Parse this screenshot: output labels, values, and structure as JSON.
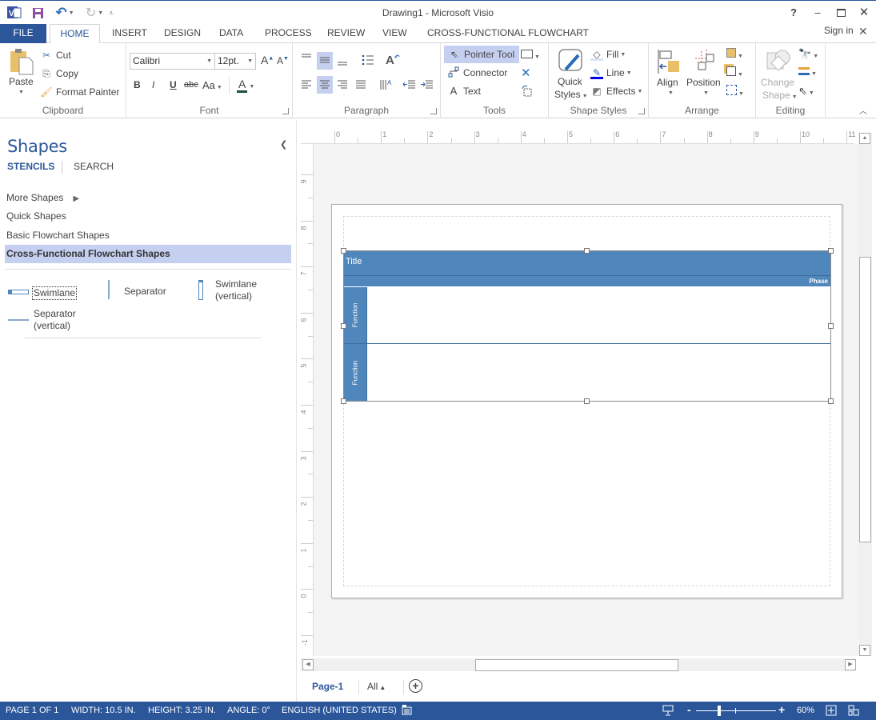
{
  "window": {
    "title": "Drawing1 - Microsoft Visio",
    "help": "?",
    "sign_in": "Sign in"
  },
  "tabs": [
    {
      "label": "FILE"
    },
    {
      "label": "HOME"
    },
    {
      "label": "INSERT"
    },
    {
      "label": "DESIGN"
    },
    {
      "label": "DATA"
    },
    {
      "label": "PROCESS"
    },
    {
      "label": "REVIEW"
    },
    {
      "label": "VIEW"
    },
    {
      "label": "CROSS-FUNCTIONAL FLOWCHART"
    }
  ],
  "ribbon": {
    "clipboard": {
      "label": "Clipboard",
      "paste": "Paste",
      "cut": "Cut",
      "copy": "Copy",
      "format_painter": "Format Painter"
    },
    "font": {
      "label": "Font",
      "font_name": "Calibri",
      "font_size": "12pt.",
      "bold": "B",
      "italic": "I",
      "underline": "U",
      "strike": "abc",
      "case": "Aa",
      "color_glyph": "A",
      "font_color": "#1f4e45"
    },
    "paragraph": {
      "label": "Paragraph"
    },
    "tools": {
      "label": "Tools",
      "pointer": "Pointer Tool",
      "connector": "Connector",
      "text": "Text"
    },
    "shape_styles": {
      "label": "Shape Styles",
      "quick_styles_1": "Quick",
      "quick_styles_2": "Styles",
      "fill": "Fill",
      "line": "Line",
      "effects": "Effects"
    },
    "arrange": {
      "label": "Arrange",
      "align": "Align",
      "position": "Position"
    },
    "editing": {
      "label": "Editing",
      "change_shape_1": "Change",
      "change_shape_2": "Shape"
    }
  },
  "shapes_panel": {
    "title": "Shapes",
    "tabs": [
      "STENCILS",
      "SEARCH"
    ],
    "stencils": [
      "More Shapes",
      "Quick Shapes",
      "Basic Flowchart Shapes",
      "Cross-Functional Flowchart Shapes"
    ],
    "active_stencil": "Cross-Functional Flowchart Shapes",
    "items": [
      {
        "label": "Swimlane"
      },
      {
        "label": "Separator"
      },
      {
        "label_1": "Swimlane",
        "label_2": "(vertical)"
      },
      {
        "label_1": "Separator",
        "label_2": "(vertical)"
      }
    ]
  },
  "rulers": {
    "horizontal": [
      "0",
      "1",
      "2",
      "3",
      "4",
      "5",
      "6",
      "7",
      "8",
      "9",
      "10",
      "11"
    ],
    "vertical": [
      "9",
      "8",
      "7",
      "6",
      "5",
      "4",
      "3",
      "2",
      "1",
      "0",
      "-1"
    ]
  },
  "diagram": {
    "title": "Title",
    "phase": "Phase",
    "lanes": [
      "Function",
      "Function"
    ],
    "fill_color": "#4f86bb"
  },
  "page_tabs": {
    "current": "Page-1",
    "all": "All"
  },
  "status_bar": {
    "page": "PAGE 1 OF 1",
    "width": "WIDTH: 10.5 IN.",
    "height": "HEIGHT: 3.25 IN.",
    "angle": "ANGLE: 0°",
    "language": "ENGLISH (UNITED STATES)",
    "zoom": "60%",
    "zoom_level_percent": 60
  }
}
